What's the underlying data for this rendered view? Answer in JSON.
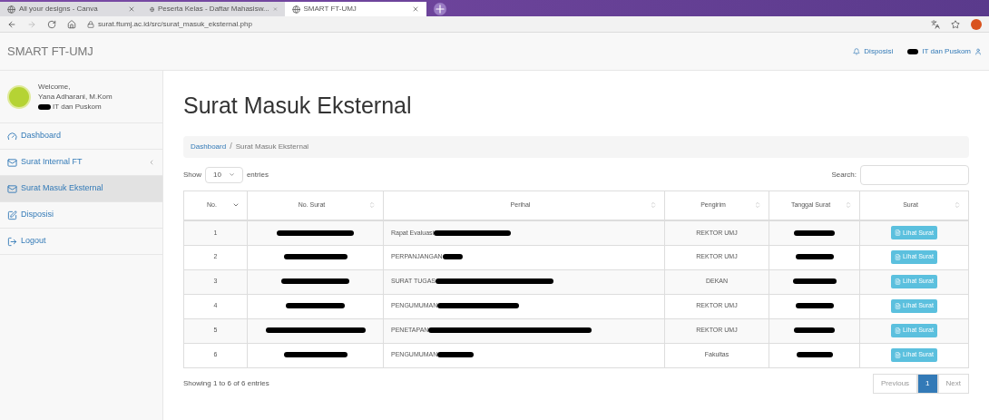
{
  "browser": {
    "tabs": [
      {
        "title": "All your designs - Canva",
        "selected": false
      },
      {
        "title": "Peserta Kelas - Daftar Mahasisw...",
        "selected": false
      },
      {
        "title": "SMART FT-UMJ",
        "selected": true
      }
    ],
    "url": "surat.ftumj.ac.id/src/surat_masuk_eksternal.php"
  },
  "navbar": {
    "brand": "SMART FT-UMJ",
    "links": [
      {
        "kind": "bell",
        "label": "Disposisi"
      },
      {
        "kind": "user",
        "label": "IT dan Puskom",
        "redacted": true
      }
    ]
  },
  "sidebar": {
    "welcome": "Welcome,",
    "user_name": "Yana Adharani, M.Kom",
    "unit": "IT dan Puskom",
    "unit_redacted": true,
    "items": [
      {
        "kind": "dashboard",
        "label": "Dashboard",
        "selected": false,
        "has_children": false
      },
      {
        "kind": "envelope",
        "label": "Surat Internal FT",
        "selected": false,
        "has_children": true
      },
      {
        "kind": "envelope",
        "label": "Surat Masuk Eksternal",
        "selected": true,
        "has_children": false
      },
      {
        "kind": "edit",
        "label": "Disposisi",
        "selected": false,
        "has_children": false
      },
      {
        "kind": "logout",
        "label": "Logout",
        "selected": false,
        "has_children": false
      }
    ]
  },
  "page": {
    "title": "Surat Masuk Eksternal",
    "breadcrumb_separator": "/",
    "breadcrumb": [
      {
        "label": "Dashboard",
        "link": true
      },
      {
        "label": "Surat Masuk Eksternal",
        "link": false
      }
    ],
    "show_label": "Show",
    "page_size": "10",
    "entries_label": "entries",
    "search_label": "Search:"
  },
  "table": {
    "columns": [
      {
        "label": "No.",
        "sorted": true
      },
      {
        "label": "No. Surat",
        "sorted": false
      },
      {
        "label": "Perihal",
        "sorted": false
      },
      {
        "label": "Pengirim",
        "sorted": false
      },
      {
        "label": "Tanggal Surat",
        "sorted": false
      },
      {
        "label": "Surat",
        "sorted": false
      }
    ],
    "rows": [
      {
        "no": "1",
        "no_surat_redacted": true,
        "perihal": "Rapat Evaluasi",
        "perihal_redacted": true,
        "pengirim": "REKTOR UMJ",
        "tanggal_redacted": true,
        "action": "Lihat Surat"
      },
      {
        "no": "2",
        "no_surat_redacted": true,
        "perihal": "PERPANJANGAN",
        "perihal_redacted": true,
        "pengirim": "REKTOR UMJ",
        "tanggal_redacted": true,
        "action": "Lihat Surat"
      },
      {
        "no": "3",
        "no_surat_redacted": true,
        "perihal": "SURAT TUGAS",
        "perihal_redacted": true,
        "pengirim": "DEKAN",
        "tanggal_redacted": true,
        "action": "Lihat Surat"
      },
      {
        "no": "4",
        "no_surat_redacted": true,
        "perihal": "PENGUMUMAN",
        "perihal_redacted": true,
        "pengirim": "REKTOR UMJ",
        "tanggal_redacted": true,
        "action": "Lihat Surat"
      },
      {
        "no": "5",
        "no_surat_redacted": true,
        "perihal": "PENETAPAN",
        "perihal_redacted": true,
        "pengirim": "REKTOR UMJ",
        "tanggal_redacted": true,
        "action": "Lihat Surat"
      },
      {
        "no": "6",
        "no_surat_redacted": true,
        "perihal": "PENGUMUMAN",
        "perihal_redacted": true,
        "pengirim": "Fakultas",
        "tanggal_redacted": true,
        "action": "Lihat Surat"
      }
    ]
  },
  "footer": {
    "info": "Showing 1 to 6 of 6 entries",
    "pagination": [
      {
        "label": "Previous",
        "selected": false
      },
      {
        "label": "1",
        "selected": true
      },
      {
        "label": "Next",
        "selected": false
      }
    ]
  }
}
